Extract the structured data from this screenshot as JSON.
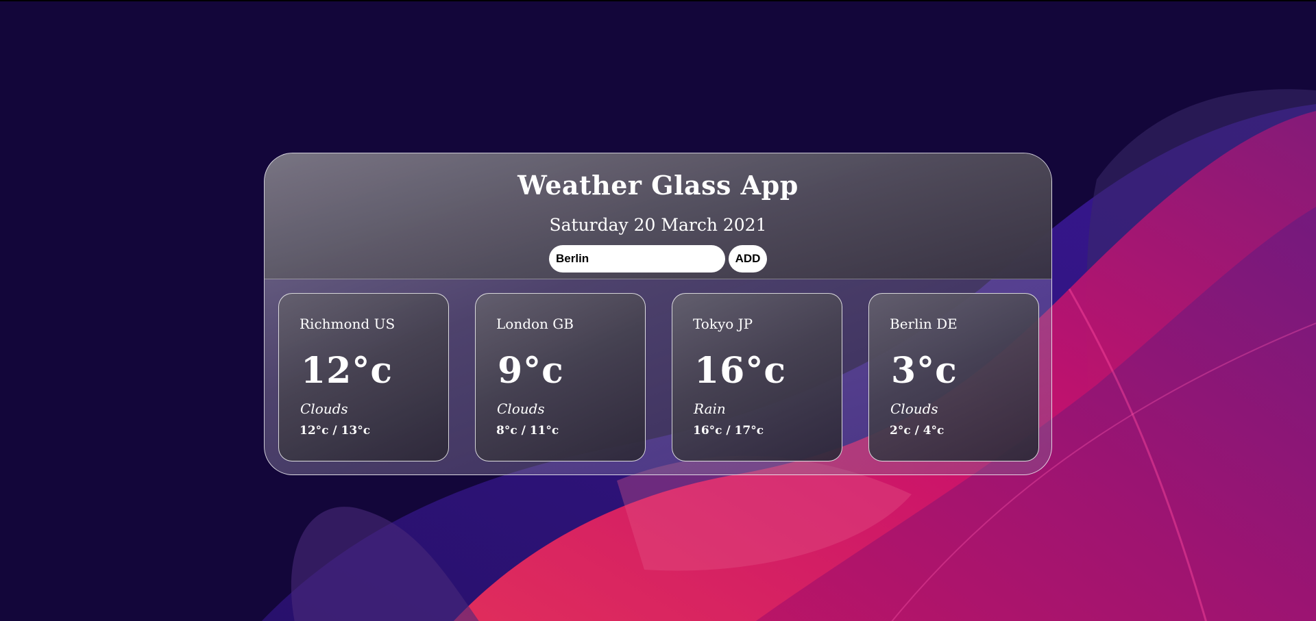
{
  "app": {
    "title": "Weather Glass App",
    "date": "Saturday 20 March 2021"
  },
  "search": {
    "value": "Berlin",
    "add_label": "ADD"
  },
  "cards": [
    {
      "city": "Richmond US",
      "temp": "12°c",
      "condition": "Clouds",
      "range": "12°c / 13°c"
    },
    {
      "city": "London GB",
      "temp": "9°c",
      "condition": "Clouds",
      "range": "8°c / 11°c"
    },
    {
      "city": "Tokyo JP",
      "temp": "16°c",
      "condition": "Rain",
      "range": "16°c / 17°c"
    },
    {
      "city": "Berlin DE",
      "temp": "3°c",
      "condition": "Clouds",
      "range": "2°c / 4°c"
    }
  ],
  "colors": {
    "background": "#13063a",
    "accent_pink": "#e0105e",
    "accent_purple": "#3a1890"
  }
}
